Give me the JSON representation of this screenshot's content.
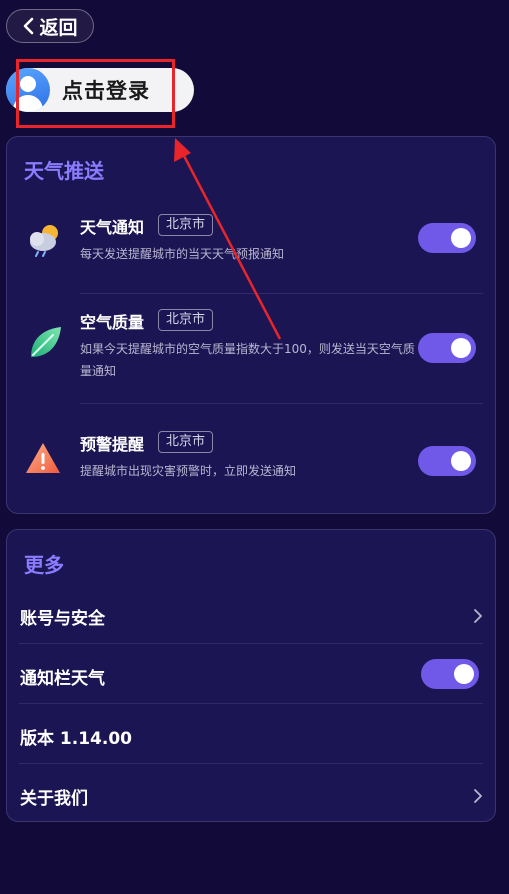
{
  "header": {
    "back_label": "返回"
  },
  "login": {
    "label": "点击登录"
  },
  "weather_push": {
    "title": "天气推送",
    "items": [
      {
        "title": "天气通知",
        "city": "北京市",
        "desc": "每天发送提醒城市的当天天气预报通知",
        "icon": "weather-cloud-sun-icon",
        "enabled": true
      },
      {
        "title": "空气质量",
        "city": "北京市",
        "desc": "如果今天提醒城市的空气质量指数大于100，则发送当天空气质量通知",
        "icon": "leaf-icon",
        "enabled": true
      },
      {
        "title": "预警提醒",
        "city": "北京市",
        "desc": "提醒城市出现灾害预警时，立即发送通知",
        "icon": "warning-triangle-icon",
        "enabled": true
      }
    ]
  },
  "more": {
    "title": "更多",
    "items": [
      {
        "label": "账号与安全",
        "control": "chevron-right-icon"
      },
      {
        "label": "通知栏天气",
        "control": "toggle",
        "enabled": true
      },
      {
        "label": "版本 1.14.00",
        "control": "none"
      },
      {
        "label": "关于我们",
        "control": "chevron-right-icon"
      }
    ]
  },
  "colors": {
    "background": "#120b3a",
    "card": "#1c1554",
    "accent": "#7058e8",
    "section_title": "#8b7cff",
    "highlight": "#e8252b"
  }
}
